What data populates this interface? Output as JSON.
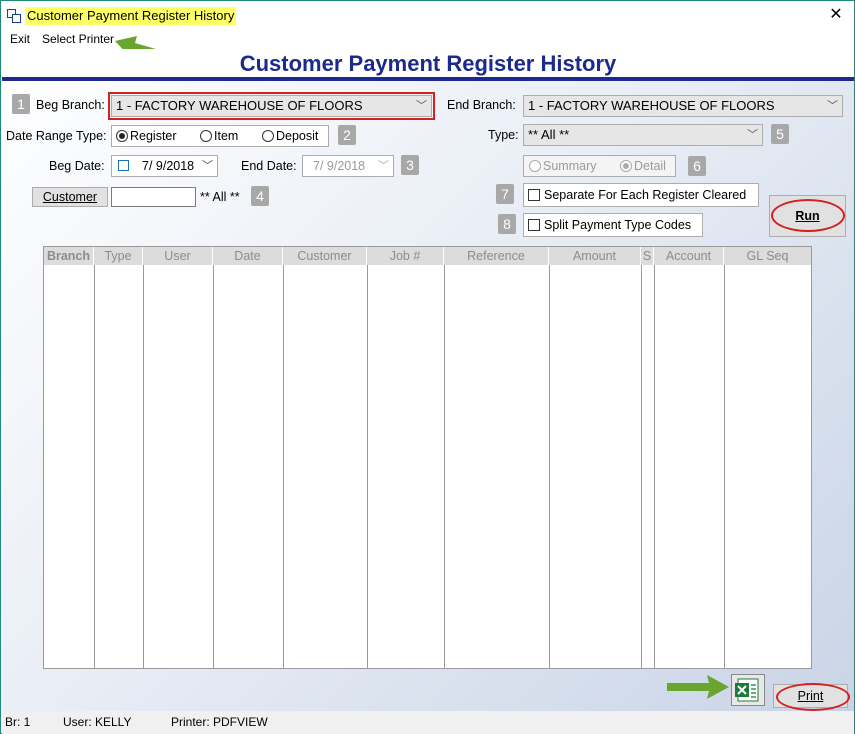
{
  "window": {
    "title": "Customer Payment Register History",
    "close_glyph": "✕"
  },
  "menu": {
    "items": [
      "Exit",
      "Select Printer"
    ]
  },
  "header": {
    "title": "Customer Payment Register History"
  },
  "badges": [
    "1",
    "2",
    "3",
    "4",
    "5",
    "6",
    "7",
    "8"
  ],
  "form": {
    "beg_branch_label": "Beg Branch:",
    "beg_branch_value": "1  - FACTORY WAREHOUSE OF FLOORS",
    "end_branch_label": "End Branch:",
    "end_branch_value": "1  - FACTORY WAREHOUSE OF FLOORS",
    "date_range_type_label": "Date Range Type:",
    "date_range_options": [
      "Register",
      "Item",
      "Deposit"
    ],
    "date_range_selected": "Register",
    "type_label": "Type:",
    "type_value": "** All **",
    "beg_date_label": "Beg Date:",
    "beg_date_value": "7/  9/2018",
    "end_date_label": "End Date:",
    "end_date_value": "7/  9/2018",
    "summary_options": [
      "Summary",
      "Detail"
    ],
    "summary_selected": "Detail",
    "customer_button": "Customer",
    "customer_value": "",
    "customer_all_text": "** All **",
    "separate_label": "Separate For Each Register Cleared",
    "split_label": "Split Payment Type Codes",
    "run_label": "Run",
    "print_label": "Print"
  },
  "grid": {
    "columns": [
      "Branch",
      "Type",
      "User",
      "Date",
      "Customer",
      "Job #",
      "Reference",
      "Amount",
      "S",
      "Account",
      "GL Seq"
    ],
    "rows": []
  },
  "status": {
    "branch": "Br: 1",
    "user": "User: KELLY",
    "printer": "Printer: PDFVIEW"
  },
  "colors": {
    "title_blue": "#1b2a8c",
    "highlight_yellow": "#ffff66",
    "annotation_red": "#d32020",
    "arrow_green": "#6aa530"
  }
}
